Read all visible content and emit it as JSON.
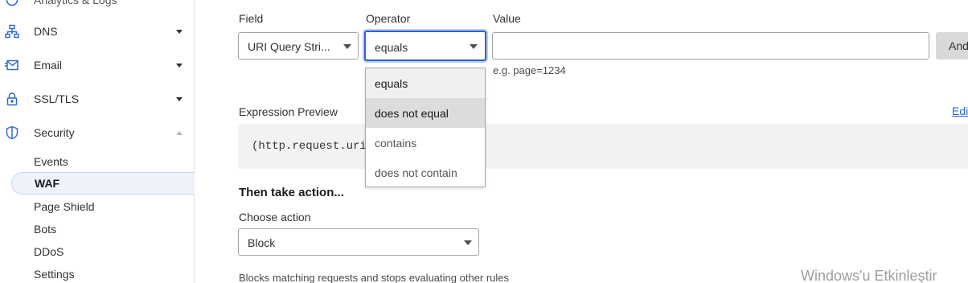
{
  "sidebar": {
    "top_partial": "Analytics & Logs",
    "items": [
      {
        "label": "DNS",
        "icon": "network-icon"
      },
      {
        "label": "Email",
        "icon": "email-icon"
      },
      {
        "label": "SSL/TLS",
        "icon": "lock-icon"
      },
      {
        "label": "Security",
        "icon": "shield-icon"
      }
    ],
    "security_subitems": [
      "Events",
      "WAF",
      "Page Shield",
      "Bots",
      "DDoS",
      "Settings"
    ],
    "active_subitem": "WAF"
  },
  "rule": {
    "field_label": "Field",
    "field_value": "URI Query Stri...",
    "operator_label": "Operator",
    "operator_value": "equals",
    "value_label": "Value",
    "value_input": "",
    "value_hint": "e.g. page=1234",
    "and_button": "And",
    "operator_options": [
      "equals",
      "does not equal",
      "contains",
      "does not contain"
    ],
    "operator_selected_index": 0,
    "operator_hovered_index": 1
  },
  "preview": {
    "label": "Expression Preview",
    "code": "(http.request.uri",
    "edit_link": "Edit"
  },
  "action": {
    "heading": "Then take action...",
    "choose_label": "Choose action",
    "choose_value": "Block",
    "description": "Blocks matching requests and stops evaluating other rules"
  },
  "watermark": "Windows'u Etkinleştir",
  "colors": {
    "accent": "#2a64d0",
    "focus_ring": "#b9cdf3",
    "active_nav_bg": "#eef3fb"
  }
}
